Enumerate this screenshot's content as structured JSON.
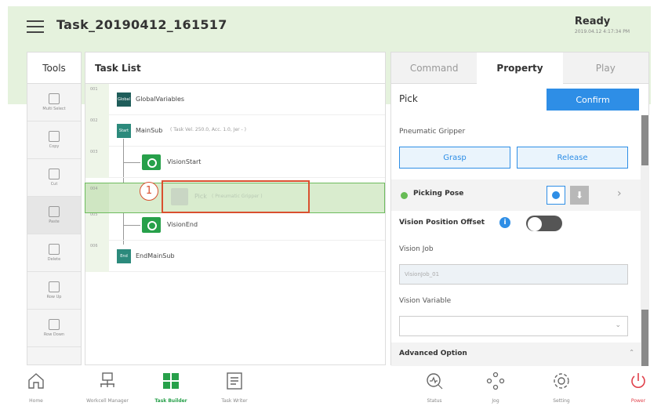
{
  "header": {
    "task_name": "Task_20190412_161517",
    "status": "Ready",
    "timestamp": "2019.04.12 4:17:34 PM"
  },
  "tools": {
    "title": "Tools",
    "items": [
      {
        "label": "Multi Select",
        "icon": "multi-select-icon"
      },
      {
        "label": "Copy",
        "icon": "copy-icon"
      },
      {
        "label": "Cut",
        "icon": "cut-icon"
      },
      {
        "label": "Paste",
        "icon": "paste-icon"
      },
      {
        "label": "Delete",
        "icon": "delete-icon"
      },
      {
        "label": "Row Up",
        "icon": "row-up-icon"
      },
      {
        "label": "Row Down",
        "icon": "row-down-icon"
      }
    ]
  },
  "task_list": {
    "title": "Task List",
    "rows": [
      {
        "line": "001",
        "badge": "Global Var.",
        "text": "GlobalVariables",
        "sub": ""
      },
      {
        "line": "002",
        "badge": "Start",
        "text": "MainSub",
        "sub": "( Task Vel. 250.0, Acc. 1.0, Jer - )"
      },
      {
        "line": "003",
        "badge": "",
        "text": "VisionStart",
        "sub": ""
      },
      {
        "line": "004",
        "badge": "",
        "text": "Pick",
        "sub": "( Pneumatic Gripper )"
      },
      {
        "line": "005",
        "badge": "",
        "text": "VisionEnd",
        "sub": ""
      },
      {
        "line": "006",
        "badge": "End",
        "text": "EndMainSub",
        "sub": ""
      }
    ],
    "callout_number": "1"
  },
  "right_panel": {
    "tabs": [
      "Command",
      "Property",
      "Play"
    ],
    "active_tab": "Property",
    "title": "Pick",
    "confirm_label": "Confirm",
    "gripper_label": "Pneumatic Gripper",
    "grasp_label": "Grasp",
    "release_label": "Release",
    "picking_pose_label": "Picking Pose",
    "vision_offset_label": "Vision Position Offset",
    "vision_offset_on": false,
    "vision_job_label": "Vision Job",
    "vision_job_value": "VisionJob_01",
    "vision_variable_label": "Vision Variable",
    "vision_variable_value": "",
    "advanced_label": "Advanced Option"
  },
  "bottom_nav": {
    "items": [
      {
        "label": "Home",
        "icon": "home-icon"
      },
      {
        "label": "Workcell Manager",
        "icon": "workcell-icon"
      },
      {
        "label": "Task Builder",
        "icon": "task-builder-icon"
      },
      {
        "label": "Task Writer",
        "icon": "task-writer-icon"
      },
      {
        "label": "Status",
        "icon": "status-icon"
      },
      {
        "label": "Jog",
        "icon": "jog-icon"
      },
      {
        "label": "Setting",
        "icon": "gear-icon"
      },
      {
        "label": "Power",
        "icon": "power-icon"
      }
    ],
    "active": "Task Builder"
  },
  "colors": {
    "header_bg": "#e5f2dd",
    "accent_blue": "#2e8ee6",
    "accent_green": "#27a04a",
    "callout_red": "#d9502f",
    "power_red": "#e0404a"
  }
}
